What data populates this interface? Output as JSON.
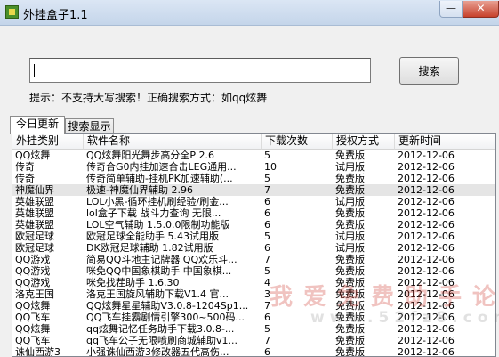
{
  "window": {
    "title": "外挂盒子1.1",
    "minimize": "—",
    "close": "✕"
  },
  "search": {
    "value": "",
    "button_label": "搜索",
    "hint": "提示：不支持大写搜索！正确搜索方式：如qq炫舞"
  },
  "tabs": [
    {
      "label": "今日更新"
    },
    {
      "label": "搜索显示"
    }
  ],
  "table": {
    "columns": [
      "外挂类别",
      "软件名称",
      "下载次数",
      "授权方式",
      "更新时间"
    ],
    "rows": [
      [
        "QQ炫舞",
        "QQ炫舞阳光舞步高分全P 2.6",
        "5",
        "免费版",
        "2012-12-06"
      ],
      [
        "传奇",
        "传奇合G0内挂加速合击LEG通用...",
        "10",
        "试用版",
        "2012-12-06"
      ],
      [
        "传奇",
        "传奇简单辅助-挂机PK加速辅助(...",
        "5",
        "免费版",
        "2012-12-06"
      ],
      [
        "神魔仙界",
        "极速-神魔仙界辅助 2.96",
        "7",
        "免费版",
        "2012-12-06"
      ],
      [
        "英雄联盟",
        "LOL小黑-循环挂机刷经验/刷金...",
        "6",
        "试用版",
        "2012-12-06"
      ],
      [
        "英雄联盟",
        "lol盒子下载 战斗力查询 无限...",
        "6",
        "免费版",
        "2012-12-06"
      ],
      [
        "英雄联盟",
        "LOL空气辅助 1.5.0.0限制功能版",
        "6",
        "免费版",
        "2012-12-06"
      ],
      [
        "欧冠足球",
        "欧冠足球全能助手 5.43试用版",
        "5",
        "试用版",
        "2012-12-06"
      ],
      [
        "欧冠足球",
        "DK欧冠足球辅助 1.82试用版",
        "6",
        "试用版",
        "2012-12-06"
      ],
      [
        "QQ游戏",
        "简易QQ斗地主记牌器 QQ欢乐斗...",
        "7",
        "免费版",
        "2012-12-06"
      ],
      [
        "QQ游戏",
        "咪免QQ中国象棋助手 中国象棋...",
        "5",
        "免费版",
        "2012-12-06"
      ],
      [
        "QQ游戏",
        "咪免找茬助手 1.6.30",
        "4",
        "免费版",
        "2012-12-06"
      ],
      [
        "洛克王国",
        "洛克王国旋风辅助下载V1.4 官...",
        "3",
        "免费版",
        "2012-12-06"
      ],
      [
        "QQ炫舞",
        "QQ炫舞星星辅助V3.0.8-1204Sp1...",
        "7",
        "免费版",
        "2012-12-06"
      ],
      [
        "QQ飞车",
        "QQ飞车挂霸剧情引擎300~500码...",
        "6",
        "免费版",
        "2012-12-06"
      ],
      [
        "QQ炫舞",
        "qq炫舞记忆任务助手下载3.0.8-...",
        "5",
        "免费版",
        "2012-12-06"
      ],
      [
        "QQ飞车",
        "qq飞车公子无限喷刷商城辅助v1...",
        "7",
        "免费版",
        "2012-12-06"
      ],
      [
        "诛仙西游3",
        "小强诛仙西游3修改器五代高伤...",
        "6",
        "免费版",
        "2012-12-06"
      ]
    ]
  },
  "watermark": {
    "main": "我爱免费助手论坛",
    "sub": "www.52fz8.com"
  }
}
